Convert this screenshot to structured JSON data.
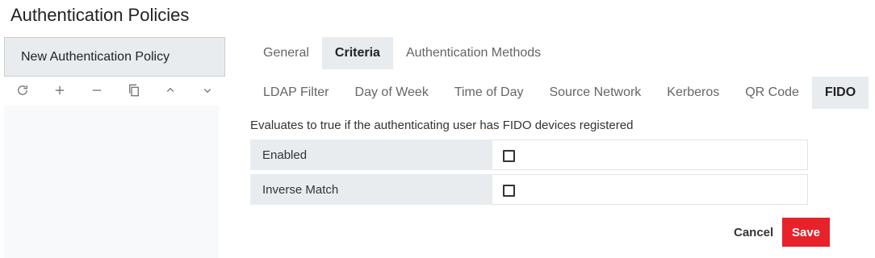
{
  "page": {
    "title": "Authentication Policies"
  },
  "sidebar": {
    "selected_policy": "New Authentication Policy",
    "toolbar": [
      {
        "name": "refresh-icon"
      },
      {
        "name": "plus-icon"
      },
      {
        "name": "minus-icon"
      },
      {
        "name": "copy-icon"
      },
      {
        "name": "chevron-up-icon"
      },
      {
        "name": "chevron-down-icon"
      }
    ]
  },
  "tabs": {
    "top": [
      "General",
      "Criteria",
      "Authentication Methods"
    ],
    "top_active": "Criteria",
    "sub": [
      "LDAP Filter",
      "Day of Week",
      "Time of Day",
      "Source Network",
      "Kerberos",
      "QR Code",
      "FIDO"
    ],
    "sub_active": "FIDO"
  },
  "criteria": {
    "description": "Evaluates to true if the authenticating user has FIDO devices registered",
    "fields": [
      {
        "label": "Enabled",
        "checked": false
      },
      {
        "label": "Inverse Match",
        "checked": false
      }
    ]
  },
  "actions": {
    "cancel": "Cancel",
    "save": "Save"
  },
  "colors": {
    "save_button": "#e8222a",
    "active_tab_bg": "#e9ecef"
  }
}
